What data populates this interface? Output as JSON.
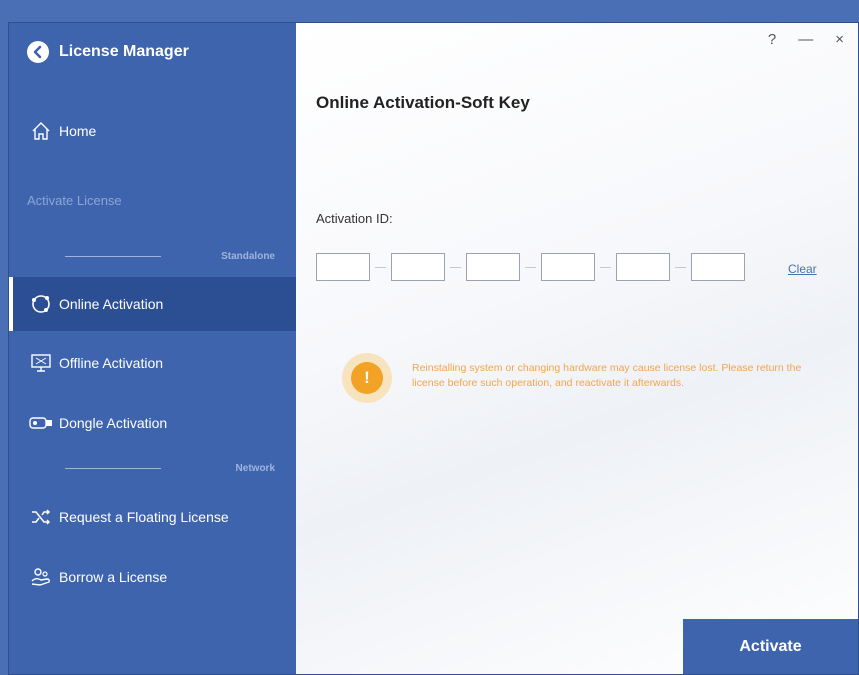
{
  "app": {
    "title": "License Manager"
  },
  "window_controls": {
    "help": "?",
    "minimize": "—",
    "close": "×"
  },
  "sidebar": {
    "home": "Home",
    "section_label": "Activate License",
    "standalone_label": "Standalone",
    "network_label": "Network",
    "items": [
      {
        "label": "Online Activation",
        "icon": "globe-icon",
        "active": true
      },
      {
        "label": "Offline Activation",
        "icon": "monitor-icon",
        "active": false
      },
      {
        "label": "Dongle Activation",
        "icon": "dongle-icon",
        "active": false
      },
      {
        "label": "Request a Floating License",
        "icon": "shuffle-icon",
        "active": false
      },
      {
        "label": "Borrow a License",
        "icon": "hand-person-icon",
        "active": false
      }
    ]
  },
  "main": {
    "title": "Online Activation-Soft Key",
    "activation_label": "Activation ID:",
    "boxes": [
      "",
      "",
      "",
      "",
      "",
      ""
    ],
    "clear_label": "Clear",
    "warning_icon": "!",
    "warning_text": "Reinstalling system or changing hardware may cause license lost. Please return the license before such operation, and reactivate it afterwards.",
    "activate_label": "Activate"
  },
  "colors": {
    "sidebar": "#3d64ad",
    "active_item": "#2c4f93",
    "accent": "#4a6fb5",
    "warning": "#f2a224"
  }
}
